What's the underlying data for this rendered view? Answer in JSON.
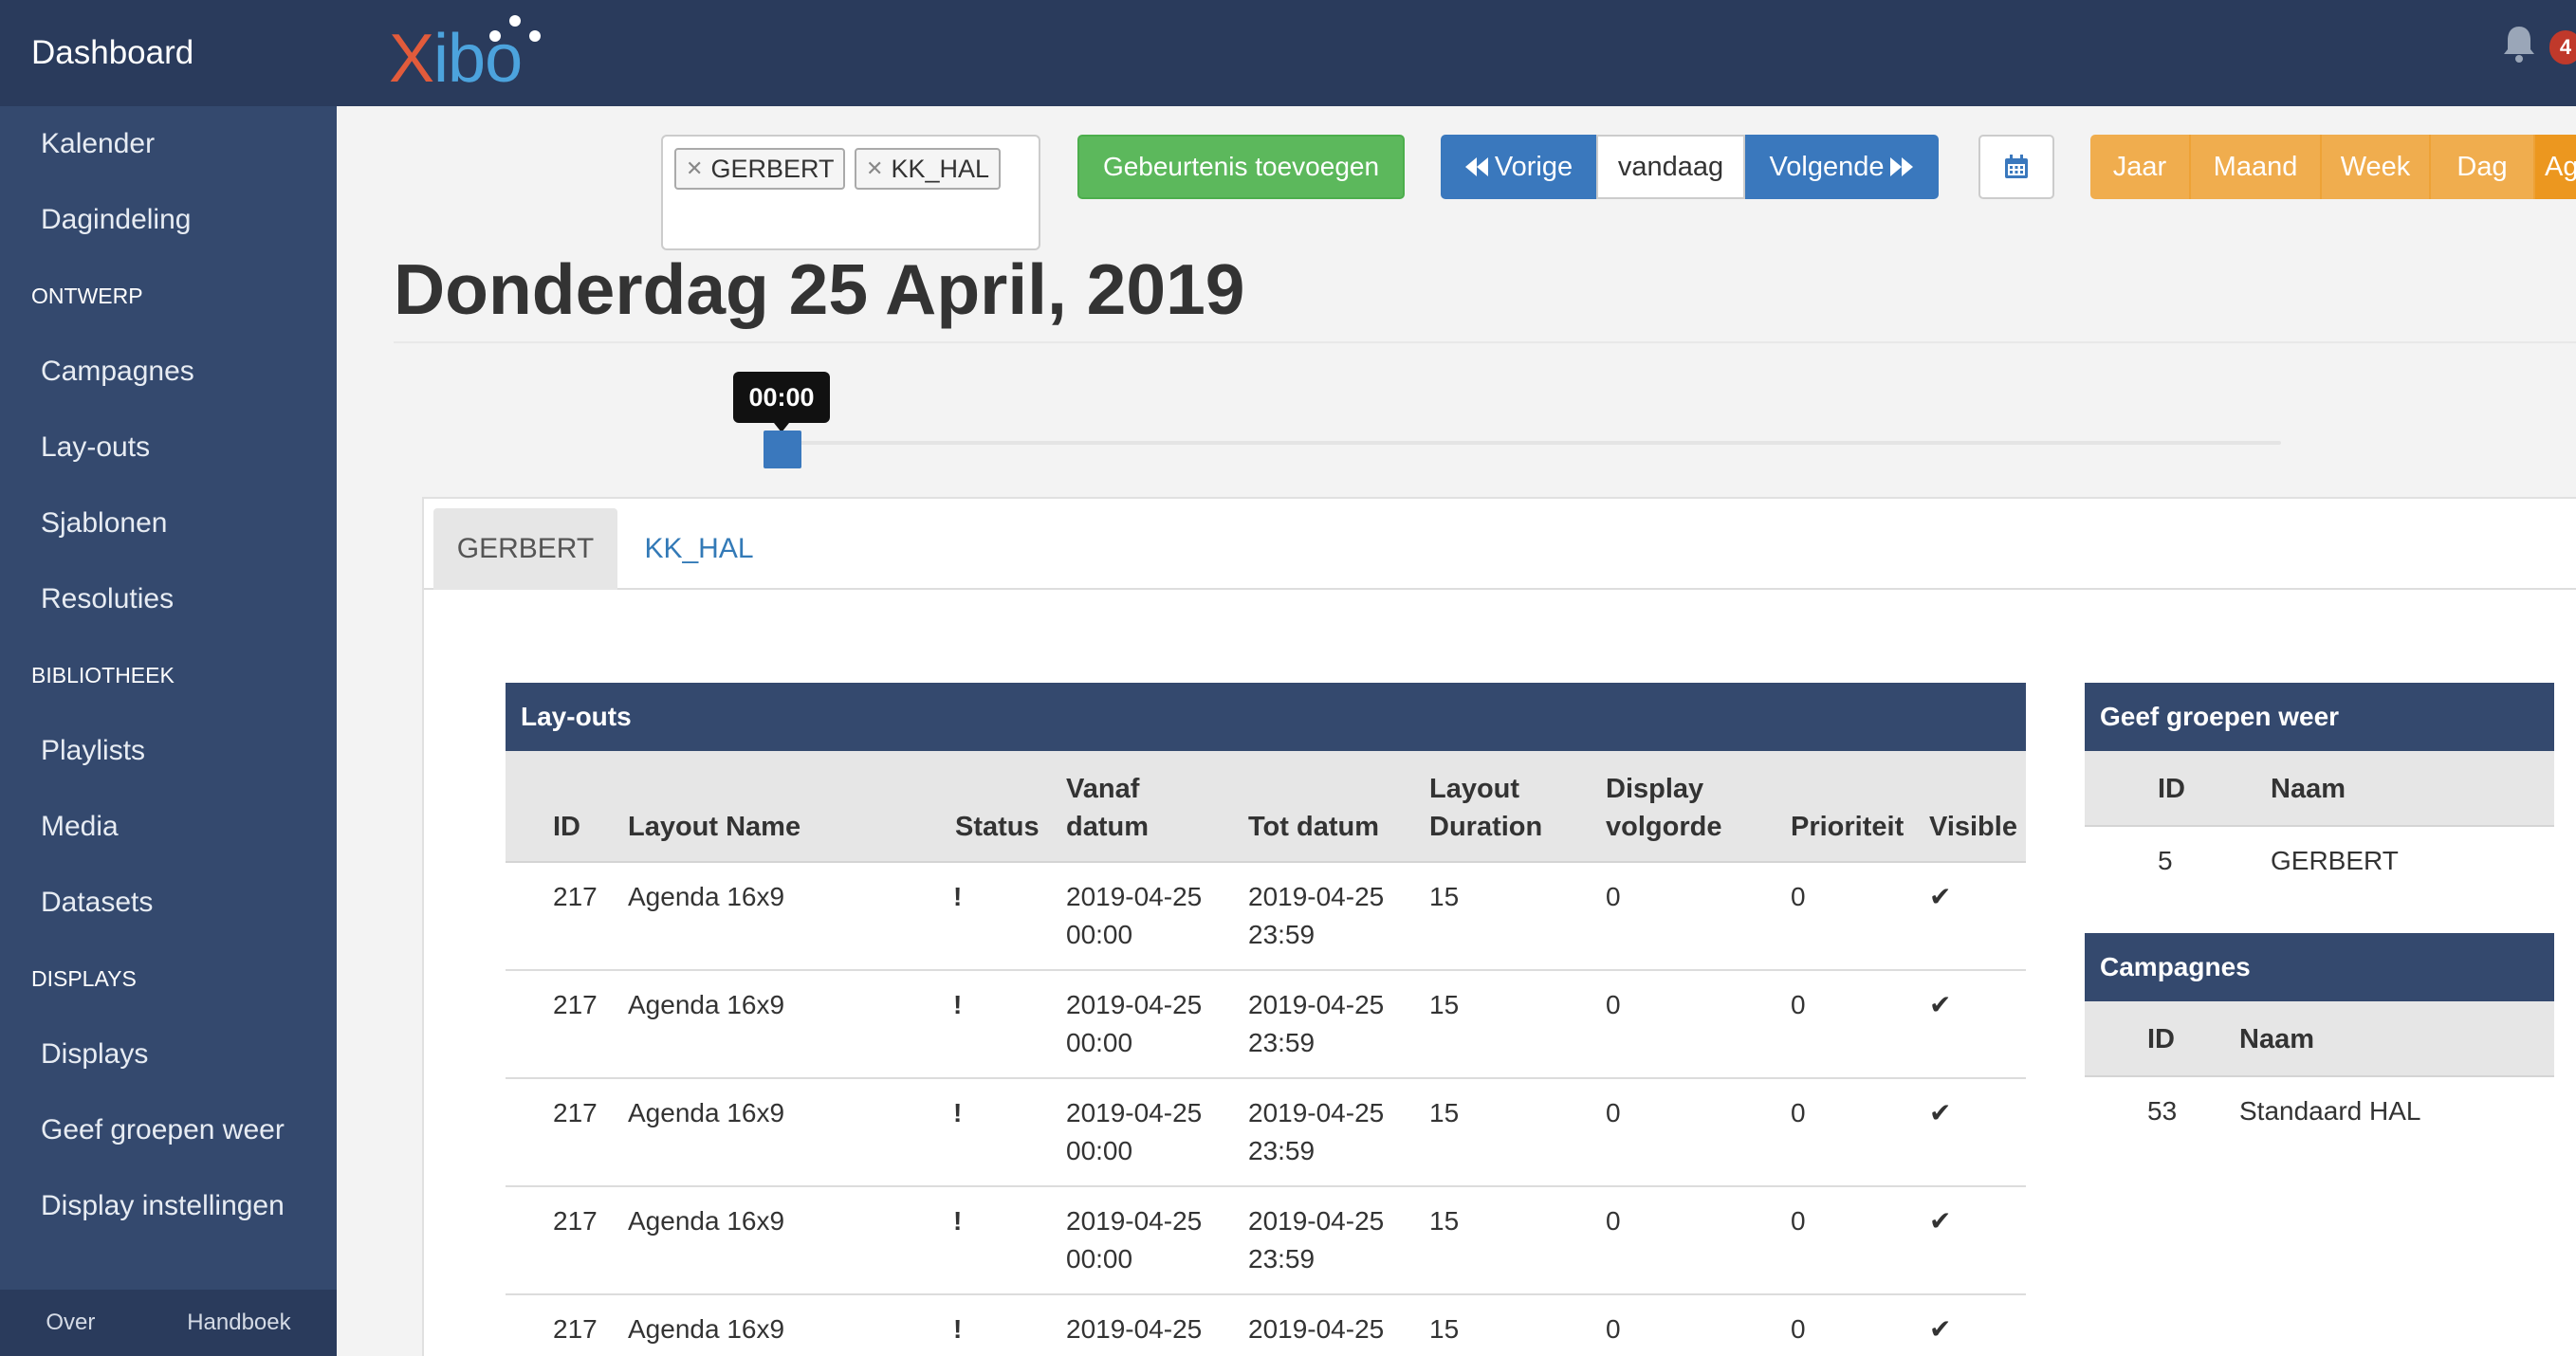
{
  "sidebar": {
    "brand": "Dashboard",
    "items": [
      {
        "type": "item",
        "label": "Kalender"
      },
      {
        "type": "item",
        "label": "Dagindeling"
      },
      {
        "type": "section",
        "label": "ONTWERP"
      },
      {
        "type": "item",
        "label": "Campagnes"
      },
      {
        "type": "item",
        "label": "Lay-outs"
      },
      {
        "type": "item",
        "label": "Sjablonen"
      },
      {
        "type": "item",
        "label": "Resoluties"
      },
      {
        "type": "section",
        "label": "BIBLIOTHEEK"
      },
      {
        "type": "item",
        "label": "Playlists"
      },
      {
        "type": "item",
        "label": "Media"
      },
      {
        "type": "item",
        "label": "Datasets"
      },
      {
        "type": "section",
        "label": "DISPLAYS"
      },
      {
        "type": "item",
        "label": "Displays"
      },
      {
        "type": "item",
        "label": "Geef groepen weer"
      },
      {
        "type": "item",
        "label": "Display instellingen"
      }
    ],
    "footer": {
      "about": "Over",
      "manual": "Handboek"
    }
  },
  "topbar": {
    "logo_x": "X",
    "logo_rest": "ibo",
    "notification_count": "4",
    "icons": [
      "bell-icon"
    ]
  },
  "toolbar": {
    "selected_groups": [
      "GERBERT",
      "KK_HAL"
    ],
    "add_event": "Gebeurtenis toevoegen",
    "prev": "Vorige",
    "today": "vandaag",
    "next": "Volgende",
    "views": [
      "Jaar",
      "Maand",
      "Week",
      "Dag",
      "Ag"
    ]
  },
  "date_title": "Donderdag 25 April, 2019",
  "slider": {
    "time": "00:00",
    "position_fraction": 0.0
  },
  "tabs": [
    "GERBERT",
    "KK_HAL"
  ],
  "layouts_table": {
    "title": "Lay-outs",
    "headers": {
      "id": "ID",
      "name": "Layout Name",
      "status": "Status",
      "from1": "Vanaf",
      "from2": "datum",
      "to": "Tot datum",
      "duration1": "Layout",
      "duration2": "Duration",
      "order1": "Display",
      "order2": "volgorde",
      "priority": "Prioriteit",
      "visible": "Visible"
    },
    "rows": [
      {
        "id": "217",
        "name": "Agenda 16x9",
        "status": "!",
        "from_date": "2019-04-25",
        "from_time": "00:00",
        "to_date": "2019-04-25",
        "to_time": "23:59",
        "duration": "15",
        "order": "0",
        "priority": "0",
        "visible": "✔"
      },
      {
        "id": "217",
        "name": "Agenda 16x9",
        "status": "!",
        "from_date": "2019-04-25",
        "from_time": "00:00",
        "to_date": "2019-04-25",
        "to_time": "23:59",
        "duration": "15",
        "order": "0",
        "priority": "0",
        "visible": "✔"
      },
      {
        "id": "217",
        "name": "Agenda 16x9",
        "status": "!",
        "from_date": "2019-04-25",
        "from_time": "00:00",
        "to_date": "2019-04-25",
        "to_time": "23:59",
        "duration": "15",
        "order": "0",
        "priority": "0",
        "visible": "✔"
      },
      {
        "id": "217",
        "name": "Agenda 16x9",
        "status": "!",
        "from_date": "2019-04-25",
        "from_time": "00:00",
        "to_date": "2019-04-25",
        "to_time": "23:59",
        "duration": "15",
        "order": "0",
        "priority": "0",
        "visible": "✔"
      },
      {
        "id": "217",
        "name": "Agenda 16x9",
        "status": "!",
        "from_date": "2019-04-25",
        "from_time": "",
        "to_date": "2019-04-25",
        "to_time": "",
        "duration": "15",
        "order": "0",
        "priority": "0",
        "visible": "✔"
      }
    ]
  },
  "display_groups_table": {
    "title": "Geef groepen weer",
    "headers": {
      "id": "ID",
      "name": "Naam"
    },
    "rows": [
      {
        "id": "5",
        "name": "GERBERT"
      }
    ]
  },
  "campaigns_table": {
    "title": "Campagnes",
    "headers": {
      "id": "ID",
      "name": "Naam"
    },
    "rows": [
      {
        "id": "53",
        "name": "Standaard HAL"
      }
    ]
  },
  "colors": {
    "sidebar": "#34496e",
    "topbar": "#2a3b5c",
    "primary": "#3a78bd",
    "success": "#5cb85c",
    "warning": "#f0ad4e",
    "danger": "#c0392b"
  }
}
